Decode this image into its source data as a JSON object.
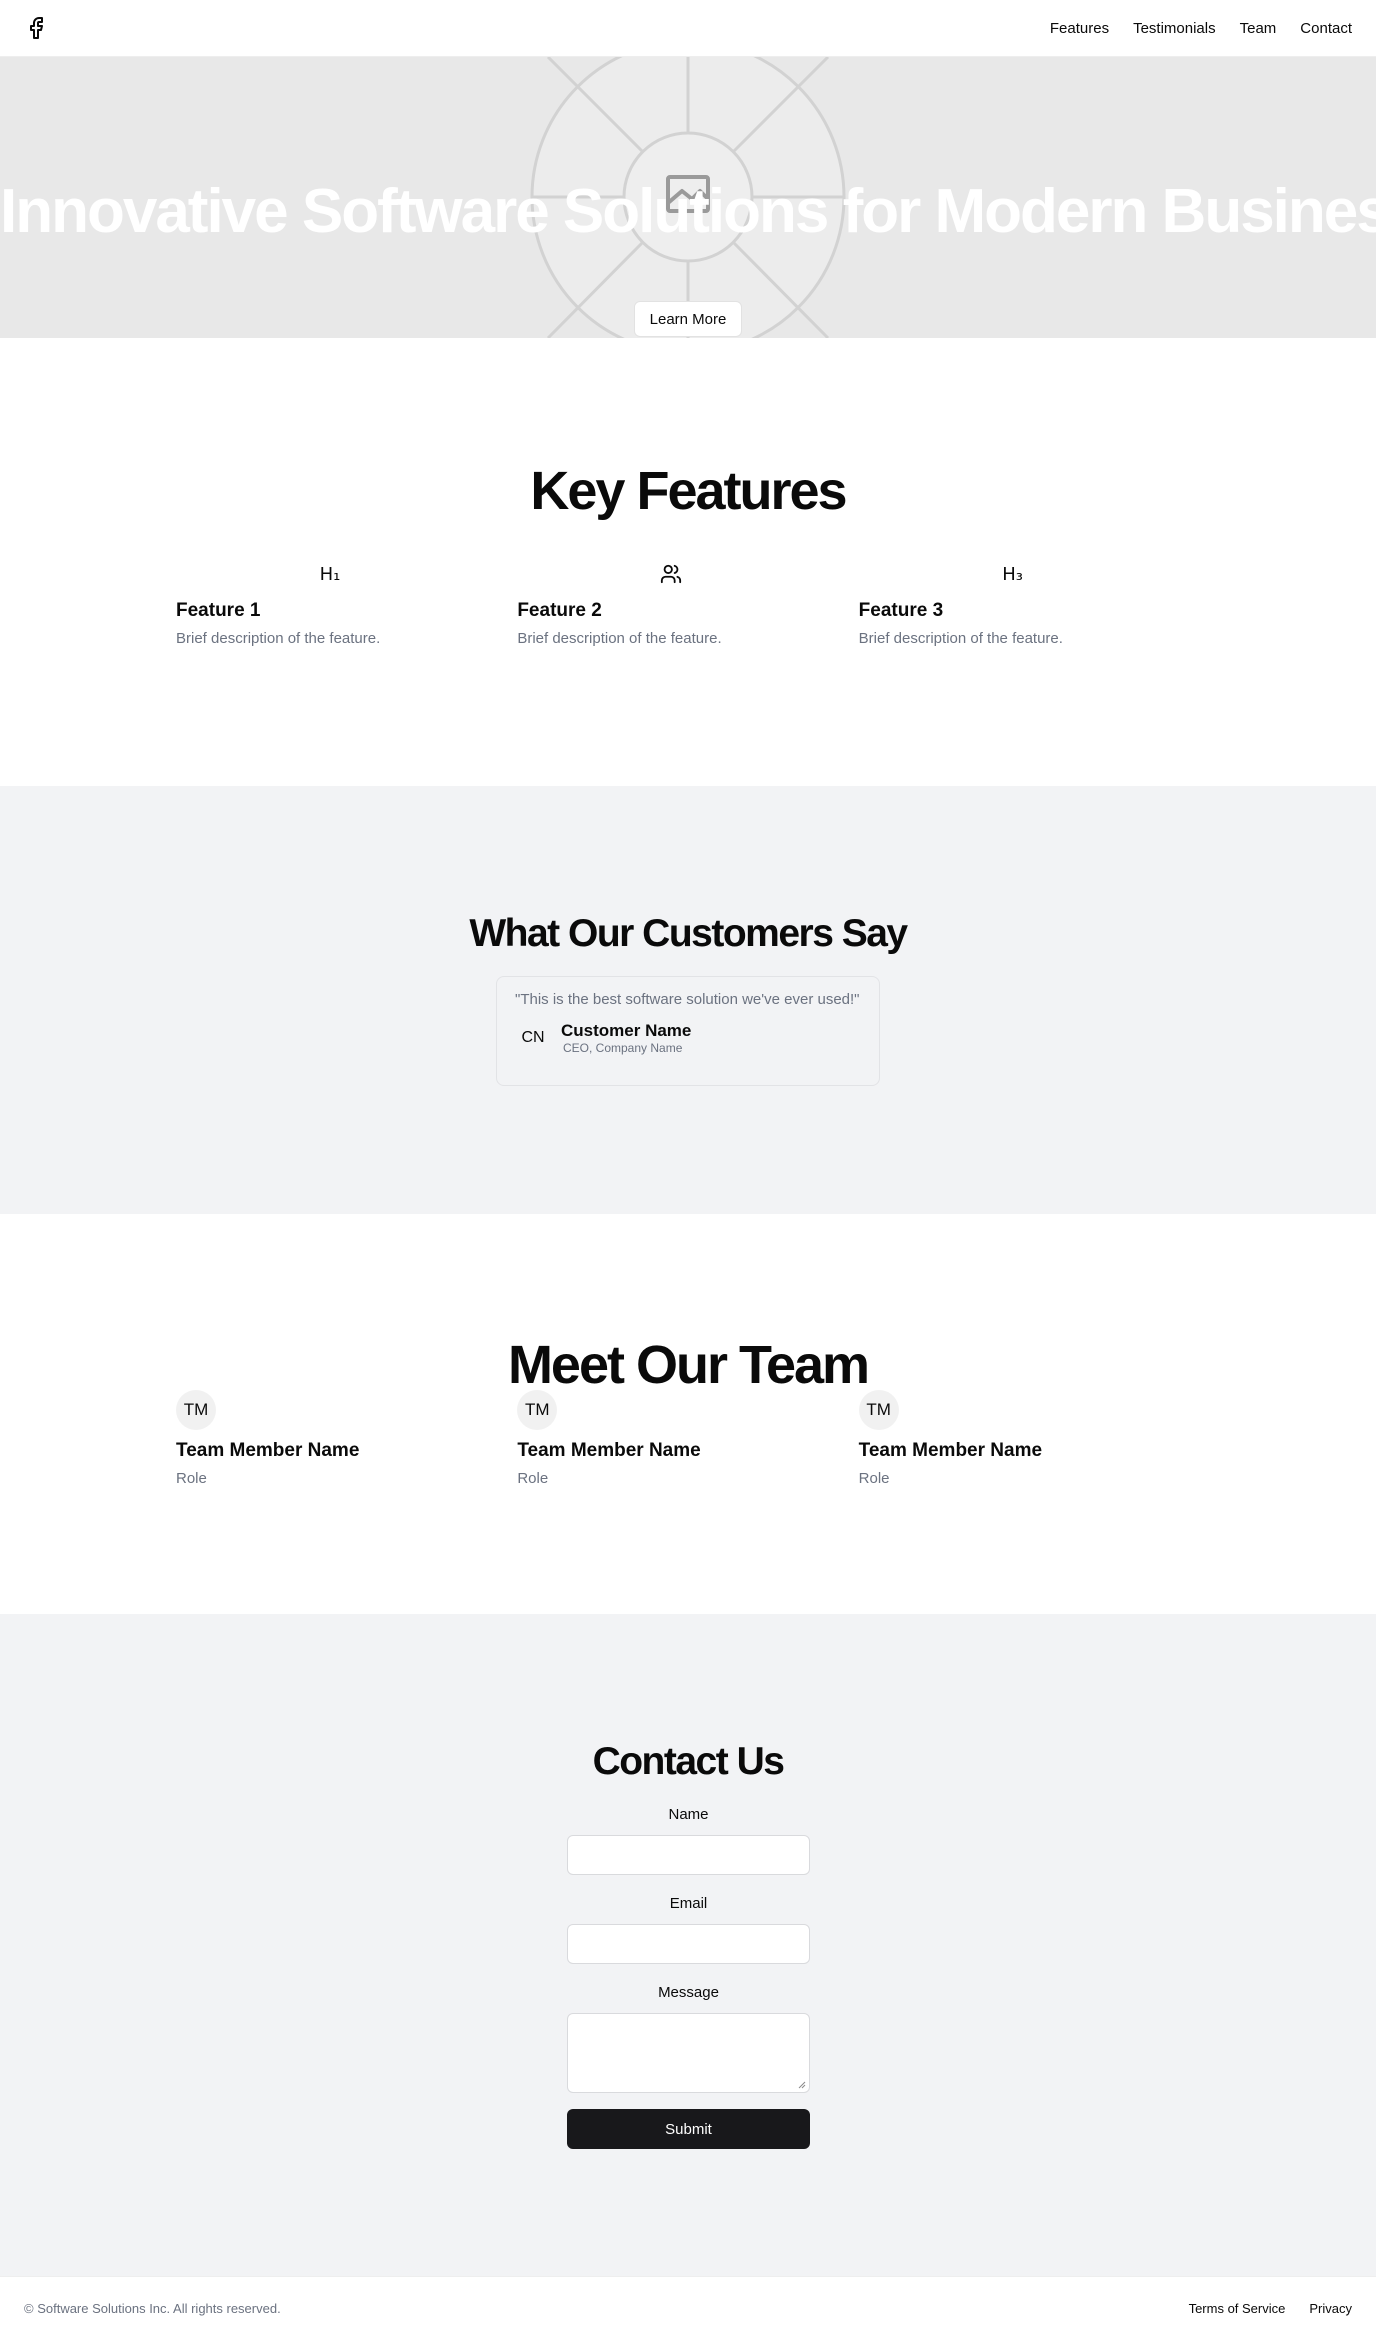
{
  "header": {
    "logo_icon": "facebook-icon",
    "nav": [
      {
        "label": "Features"
      },
      {
        "label": "Testimonials"
      },
      {
        "label": "Team"
      },
      {
        "label": "Contact"
      }
    ]
  },
  "hero": {
    "title": "Innovative Software Solutions for Modern Businesses",
    "cta_label": "Learn More",
    "image_icon": "image-placeholder-icon"
  },
  "features": {
    "title": "Key Features",
    "items": [
      {
        "icon": "heading-1-icon",
        "icon_text": "H₁",
        "name": "Feature 1",
        "description": "Brief description of the feature."
      },
      {
        "icon": "users-icon",
        "icon_text": "",
        "name": "Feature 2",
        "description": "Brief description of the feature."
      },
      {
        "icon": "heading-3-icon",
        "icon_text": "H₃",
        "name": "Feature 3",
        "description": "Brief description of the feature."
      }
    ]
  },
  "testimonials": {
    "title": "What Our Customers Say",
    "quote": "\"This is the best software solution we've ever used!\"",
    "avatar_initials": "CN",
    "name": "Customer Name",
    "role": "CEO, Company Name"
  },
  "team": {
    "title": "Meet Our Team",
    "members": [
      {
        "initials": "TM",
        "name": "Team Member Name",
        "role": "Role"
      },
      {
        "initials": "TM",
        "name": "Team Member Name",
        "role": "Role"
      },
      {
        "initials": "TM",
        "name": "Team Member Name",
        "role": "Role"
      }
    ]
  },
  "contact": {
    "title": "Contact Us",
    "name_label": "Name",
    "email_label": "Email",
    "message_label": "Message",
    "submit_label": "Submit"
  },
  "footer": {
    "copyright": "© Software Solutions Inc. All rights reserved.",
    "links": [
      {
        "label": "Terms of Service"
      },
      {
        "label": "Privacy"
      }
    ]
  },
  "colors": {
    "hero_bg": "#e8e8e8",
    "section_alt_bg": "#f2f3f5",
    "primary_button": "#18181b",
    "muted_text": "#6b7280"
  }
}
